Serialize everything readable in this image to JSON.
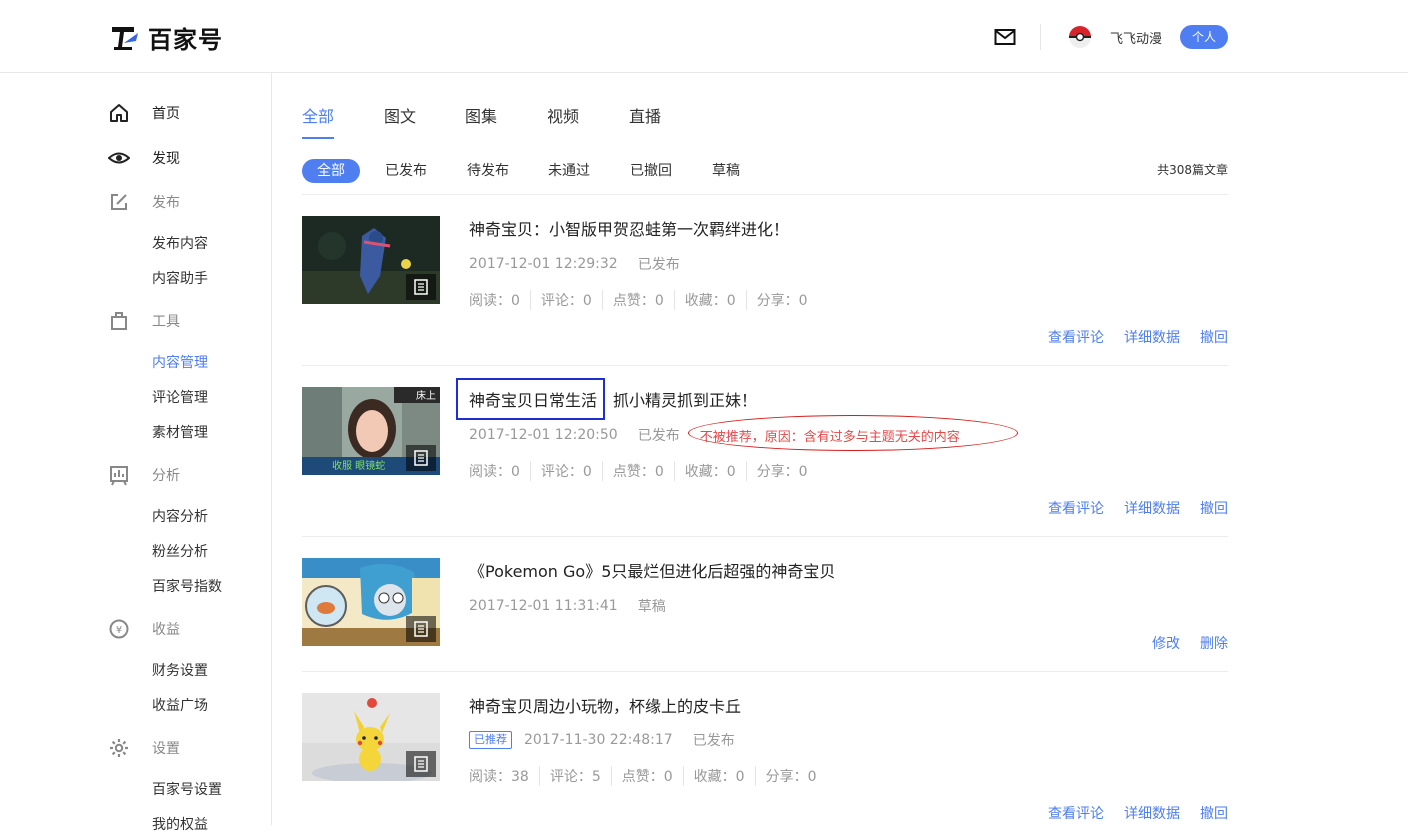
{
  "header": {
    "brand": "百家号",
    "username": "飞飞动漫",
    "account_type": "个人"
  },
  "sidebar": {
    "home": "首页",
    "discover": "发现",
    "publish": "发布",
    "publish_items": [
      "发布内容",
      "内容助手"
    ],
    "tools": "工具",
    "tools_items": [
      "内容管理",
      "评论管理",
      "素材管理"
    ],
    "analysis": "分析",
    "analysis_items": [
      "内容分析",
      "粉丝分析",
      "百家号指数"
    ],
    "earnings": "收益",
    "earnings_items": [
      "财务设置",
      "收益广场"
    ],
    "settings": "设置",
    "settings_items": [
      "百家号设置",
      "我的权益"
    ]
  },
  "tabs": [
    "全部",
    "图文",
    "图集",
    "视频",
    "直播"
  ],
  "filters": [
    "全部",
    "已发布",
    "待发布",
    "未通过",
    "已撤回",
    "草稿"
  ],
  "article_count": "共308篇文章",
  "articles": [
    {
      "title": "神奇宝贝：小智版甲贺忍蛙第一次羁绊进化！",
      "date": "2017-12-01 12:29:32",
      "status": "已发布",
      "stats": [
        "阅读：0",
        "评论：0",
        "点赞：0",
        "收藏：0",
        "分享：0"
      ],
      "actions": [
        "查看评论",
        "详细数据",
        "撤回"
      ]
    },
    {
      "title_part1": "神奇宝贝日常生活",
      "title_part2": "抓小精灵抓到正妹！",
      "date": "2017-12-01 12:20:50",
      "status": "已发布",
      "reason": "不被推荐，原因：含有过多与主题无关的内容",
      "stats": [
        "阅读：0",
        "评论：0",
        "点赞：0",
        "收藏：0",
        "分享：0"
      ],
      "actions": [
        "查看评论",
        "详细数据",
        "撤回"
      ]
    },
    {
      "title": "《Pokemon Go》5只最烂但进化后超强的神奇宝贝",
      "date": "2017-12-01 11:31:41",
      "status": "草稿",
      "actions": [
        "修改",
        "删除"
      ]
    },
    {
      "title": "神奇宝贝周边小玩物，杯缘上的皮卡丘",
      "badge": "已推荐",
      "date": "2017-11-30 22:48:17",
      "status": "已发布",
      "stats": [
        "阅读：38",
        "评论：5",
        "点赞：0",
        "收藏：0",
        "分享：0"
      ],
      "actions": [
        "查看评论",
        "详细数据",
        "撤回"
      ]
    }
  ],
  "colors": {
    "accent": "#4e7eef",
    "warning": "#e24a4a",
    "annotation_box": "#1f2ecf",
    "annotation_ring": "#d51b1b"
  }
}
